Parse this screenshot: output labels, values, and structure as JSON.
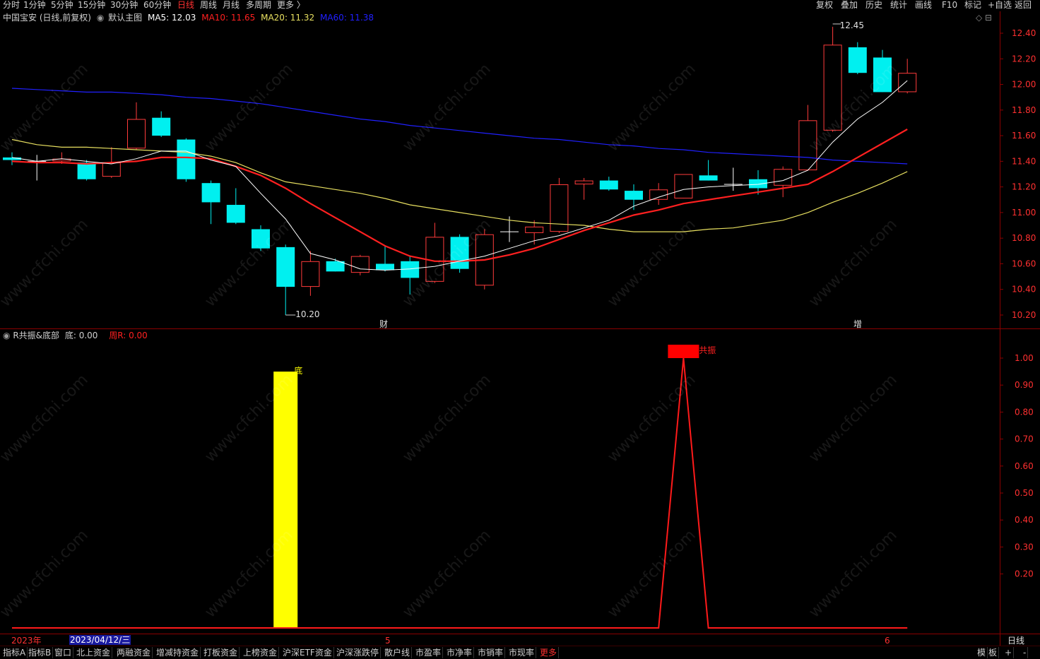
{
  "toolbar": {
    "periods": [
      "分时",
      "1分钟",
      "5分钟",
      "15分钟",
      "30分钟",
      "60分钟",
      "日线",
      "周线",
      "月线",
      "多周期",
      "更多 〉"
    ],
    "active_period": "日线",
    "right_buttons": [
      "复权",
      "叠加",
      "历史",
      "统计",
      "画线",
      "F10",
      "标记",
      "+自选",
      "返回"
    ]
  },
  "main_chart": {
    "stock": "中国宝安 (日线,前复权)",
    "template": "默认主图",
    "ma5_label": "MA5: 12.03",
    "ma10_label": "MA10: 11.65",
    "ma20_label": "MA20: 11.32",
    "ma60_label": "MA60: 11.38",
    "high_label": "12.45",
    "low_label": "10.20",
    "marker_cai": "财",
    "marker_zeng": "增",
    "y_ticks": [
      "12.40",
      "12.20",
      "12.00",
      "11.80",
      "11.60",
      "11.40",
      "11.20",
      "11.00",
      "10.80",
      "10.60",
      "10.40",
      "10.20"
    ],
    "colors": {
      "up": "#ff3b3b",
      "down": "#00f0f0",
      "ma5": "#ffffff",
      "ma10": "#ff2020",
      "ma20": "#e8e060",
      "ma60": "#2020ff"
    }
  },
  "chart_data": [
    {
      "type": "candlestick",
      "title": "中国宝安 (日线,前复权)",
      "ylim": [
        10.15,
        12.5
      ],
      "candles": [
        {
          "o": 11.43,
          "h": 11.47,
          "l": 11.37,
          "c": 11.41
        },
        {
          "o": 11.4,
          "h": 11.45,
          "l": 11.25,
          "c": 11.4
        },
        {
          "o": 11.4,
          "h": 11.47,
          "l": 11.38,
          "c": 11.42
        },
        {
          "o": 11.39,
          "h": 11.41,
          "l": 11.25,
          "c": 11.26
        },
        {
          "o": 11.28,
          "h": 11.51,
          "l": 11.27,
          "c": 11.39
        },
        {
          "o": 11.5,
          "h": 11.86,
          "l": 11.49,
          "c": 11.73
        },
        {
          "o": 11.74,
          "h": 11.79,
          "l": 11.59,
          "c": 11.6
        },
        {
          "o": 11.57,
          "h": 11.58,
          "l": 11.24,
          "c": 11.26
        },
        {
          "o": 11.23,
          "h": 11.25,
          "l": 10.91,
          "c": 11.08
        },
        {
          "o": 11.06,
          "h": 11.19,
          "l": 10.91,
          "c": 10.92
        },
        {
          "o": 10.87,
          "h": 10.9,
          "l": 10.7,
          "c": 10.72
        },
        {
          "o": 10.73,
          "h": 10.75,
          "l": 10.2,
          "c": 10.42
        },
        {
          "o": 10.42,
          "h": 10.7,
          "l": 10.35,
          "c": 10.62
        },
        {
          "o": 10.62,
          "h": 10.64,
          "l": 10.54,
          "c": 10.54
        },
        {
          "o": 10.53,
          "h": 10.67,
          "l": 10.51,
          "c": 10.66
        },
        {
          "o": 10.6,
          "h": 10.74,
          "l": 10.54,
          "c": 10.55
        },
        {
          "o": 10.62,
          "h": 10.66,
          "l": 10.36,
          "c": 10.49
        },
        {
          "o": 10.46,
          "h": 10.92,
          "l": 10.45,
          "c": 10.81
        },
        {
          "o": 10.81,
          "h": 10.83,
          "l": 10.53,
          "c": 10.56
        },
        {
          "o": 10.43,
          "h": 10.87,
          "l": 10.4,
          "c": 10.83
        },
        {
          "o": 10.85,
          "h": 10.97,
          "l": 10.77,
          "c": 10.85
        },
        {
          "o": 10.84,
          "h": 10.94,
          "l": 10.75,
          "c": 10.89
        },
        {
          "o": 10.85,
          "h": 11.27,
          "l": 10.84,
          "c": 11.22
        },
        {
          "o": 11.22,
          "h": 11.27,
          "l": 11.1,
          "c": 11.25
        },
        {
          "o": 11.25,
          "h": 11.28,
          "l": 11.17,
          "c": 11.18
        },
        {
          "o": 11.17,
          "h": 11.22,
          "l": 11.02,
          "c": 11.1
        },
        {
          "o": 11.1,
          "h": 11.23,
          "l": 11.06,
          "c": 11.18
        },
        {
          "o": 11.11,
          "h": 11.3,
          "l": 11.11,
          "c": 11.3
        },
        {
          "o": 11.29,
          "h": 11.41,
          "l": 11.25,
          "c": 11.25
        },
        {
          "o": 11.22,
          "h": 11.35,
          "l": 11.17,
          "c": 11.22
        },
        {
          "o": 11.26,
          "h": 11.33,
          "l": 11.14,
          "c": 11.19
        },
        {
          "o": 11.21,
          "h": 11.36,
          "l": 11.12,
          "c": 11.34
        },
        {
          "o": 11.33,
          "h": 11.84,
          "l": 11.33,
          "c": 11.72
        },
        {
          "o": 11.64,
          "h": 12.45,
          "l": 11.63,
          "c": 12.31
        },
        {
          "o": 12.29,
          "h": 12.33,
          "l": 12.08,
          "c": 12.09
        },
        {
          "o": 12.21,
          "h": 12.27,
          "l": 11.94,
          "c": 11.94
        },
        {
          "o": 11.94,
          "h": 12.2,
          "l": 11.93,
          "c": 12.09
        }
      ],
      "ma5": [
        11.43,
        11.4,
        11.42,
        11.4,
        11.38,
        11.42,
        11.48,
        11.48,
        11.41,
        11.36,
        11.15,
        10.95,
        10.68,
        10.63,
        10.56,
        10.55,
        10.56,
        10.58,
        10.62,
        10.66,
        10.72,
        10.78,
        10.82,
        10.88,
        10.94,
        11.05,
        11.12,
        11.18,
        11.2,
        11.21,
        11.22,
        11.25,
        11.33,
        11.55,
        11.73,
        11.86,
        12.03
      ],
      "ma10": [
        11.4,
        11.39,
        11.39,
        11.38,
        11.39,
        11.4,
        11.43,
        11.43,
        11.42,
        11.36,
        11.29,
        11.19,
        11.07,
        10.96,
        10.85,
        10.74,
        10.66,
        10.62,
        10.62,
        10.63,
        10.67,
        10.72,
        10.79,
        10.86,
        10.92,
        10.98,
        11.02,
        11.07,
        11.1,
        11.13,
        11.16,
        11.19,
        11.22,
        11.32,
        11.43,
        11.54,
        11.65
      ],
      "ma20": [
        11.57,
        11.53,
        11.51,
        11.51,
        11.5,
        11.49,
        11.48,
        11.47,
        11.44,
        11.39,
        11.31,
        11.24,
        11.21,
        11.18,
        11.15,
        11.11,
        11.06,
        11.03,
        11.0,
        10.97,
        10.94,
        10.92,
        10.91,
        10.9,
        10.87,
        10.85,
        10.85,
        10.85,
        10.87,
        10.88,
        10.91,
        10.94,
        11.0,
        11.08,
        11.15,
        11.23,
        11.32
      ],
      "ma60": [
        11.97,
        11.96,
        11.95,
        11.94,
        11.94,
        11.93,
        11.92,
        11.9,
        11.89,
        11.87,
        11.85,
        11.82,
        11.79,
        11.76,
        11.73,
        11.71,
        11.68,
        11.66,
        11.64,
        11.62,
        11.6,
        11.58,
        11.57,
        11.55,
        11.53,
        11.52,
        11.5,
        11.49,
        11.47,
        11.46,
        11.45,
        11.44,
        11.43,
        11.41,
        11.4,
        11.39,
        11.38
      ]
    },
    {
      "type": "bar",
      "title": "R共振&底部",
      "ylim": [
        0,
        1.1
      ],
      "di_values": [
        0,
        0,
        0,
        0,
        0,
        0,
        0,
        0,
        0,
        0,
        0,
        0.95,
        0,
        0,
        0,
        0,
        0,
        0,
        0,
        0,
        0,
        0,
        0,
        0,
        0,
        0,
        0,
        0,
        0,
        0,
        0,
        0,
        0,
        0,
        0,
        0,
        0
      ],
      "zhou_values": [
        0,
        0,
        0,
        0,
        0,
        0,
        0,
        0,
        0,
        0,
        0,
        0,
        0,
        0,
        0,
        0,
        0,
        0,
        0,
        0,
        0,
        0,
        0,
        0,
        0,
        0,
        0,
        1,
        0,
        0,
        0,
        0,
        0,
        0,
        0,
        0,
        0
      ]
    }
  ],
  "sub_chart": {
    "indicator": "R共振&底部",
    "di_label": "底: 0.00",
    "zhou_label": "周R: 0.00",
    "di_marker": "底",
    "gongzhen_marker": "共振",
    "y_ticks": [
      "1.00",
      "0.90",
      "0.80",
      "0.70",
      "0.60",
      "0.50",
      "0.40",
      "0.30",
      "0.20"
    ]
  },
  "x_axis": {
    "year_label": "2023年",
    "cursor_date": "2023/04/12/三",
    "month_5": "5",
    "month_6": "6",
    "period_label": "日线"
  },
  "bottombar": {
    "tabs": [
      "指标A",
      "指标B",
      "窗口",
      "北上资金",
      "两融资金",
      "增减持资金",
      "打板资金",
      "上榜资金",
      "沪深ETF资金",
      "沪深涨跌停",
      "散户线",
      "市盈率",
      "市净率",
      "市销率",
      "市现率",
      "更多"
    ],
    "right": [
      "模",
      "板",
      "+",
      "-"
    ]
  },
  "watermark": "www.cfchi.com"
}
